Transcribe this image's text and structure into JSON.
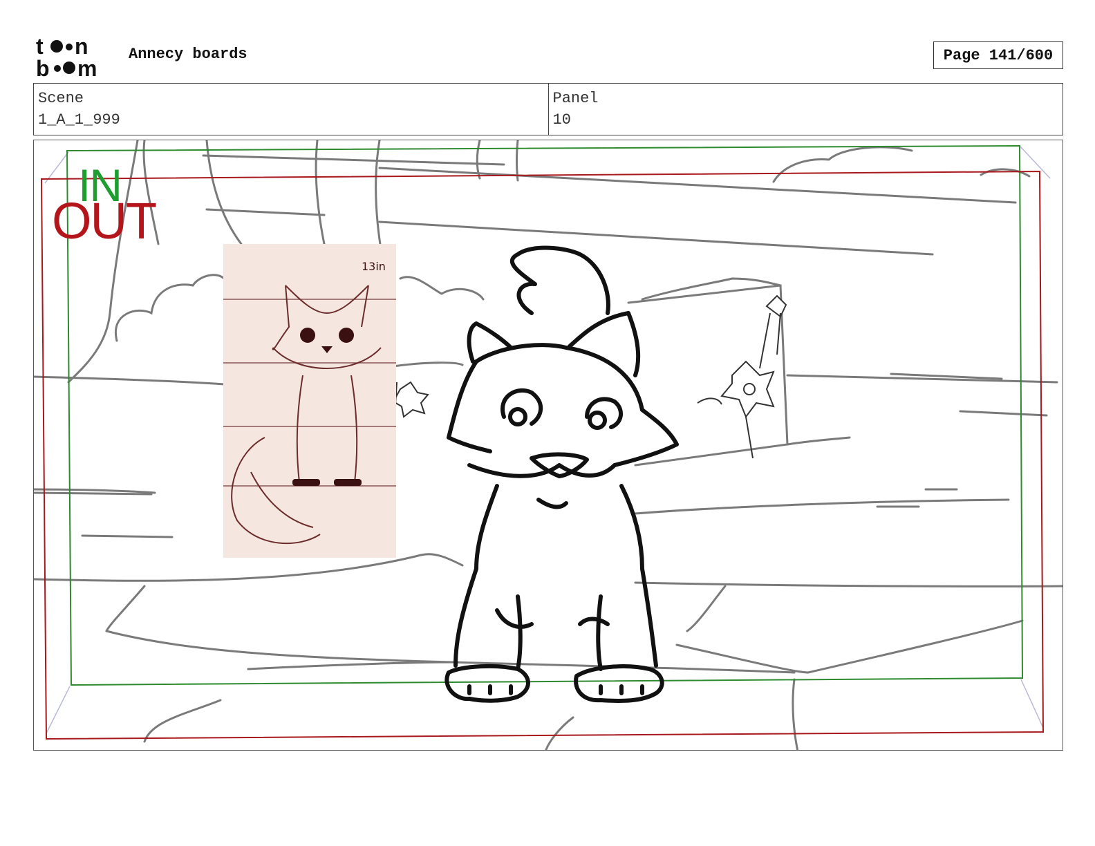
{
  "header": {
    "logo_alt": "toon boom",
    "project_title": "Annecy boards",
    "page_indicator": "Page 141/600"
  },
  "info": {
    "scene_label": "Scene",
    "scene_value": "1_A_1_999",
    "panel_label": "Panel",
    "panel_value": "10"
  },
  "panel": {
    "in_label": "IN",
    "out_label": "OUT",
    "ref_note": "13in",
    "colors": {
      "in_frame": "#2e8a2e",
      "out_frame": "#a8181c",
      "in_text": "#1e9e2e",
      "out_text": "#b3151a",
      "background_lines": "#7a7a7a",
      "character_lines": "#111111",
      "ref_card": "#f5e6df",
      "ref_sketch": "#6b2c2c"
    }
  }
}
